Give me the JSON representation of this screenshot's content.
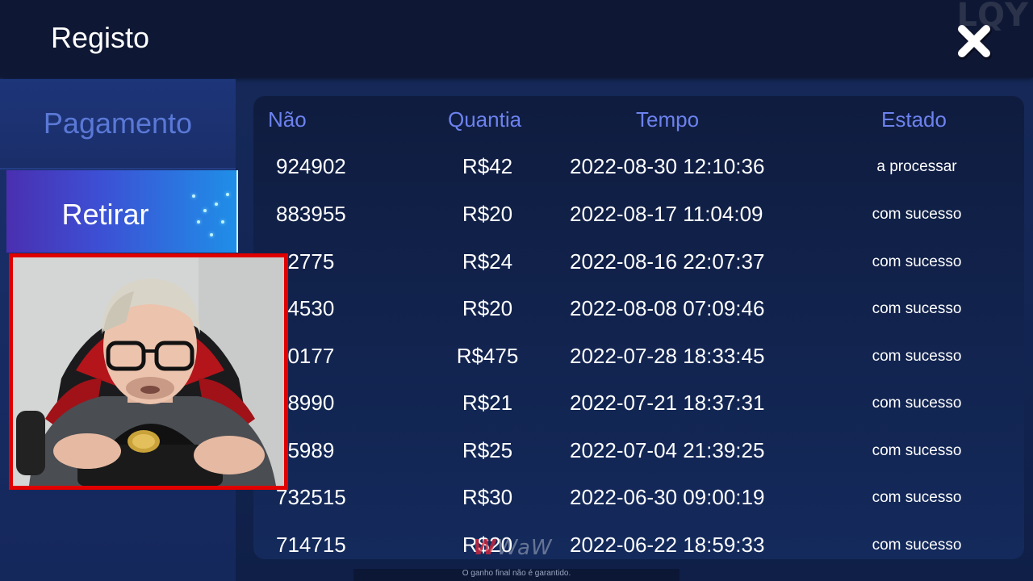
{
  "header": {
    "title": "Registo",
    "watermark": "LQY",
    "close_icon": "close-icon"
  },
  "sidebar": {
    "tabs": [
      {
        "label": "Pagamento",
        "active": false
      },
      {
        "label": "Retirar",
        "active": true
      }
    ]
  },
  "table": {
    "columns": [
      "Não",
      "Quantia",
      "Tempo",
      "Estado"
    ],
    "rows": [
      {
        "no": "924902",
        "amount": "R$42",
        "time": "2022-08-30 12:10:36",
        "status": "a processar"
      },
      {
        "no": "883955",
        "amount": "R$20",
        "time": "2022-08-17 11:04:09",
        "status": "com sucesso"
      },
      {
        "no": "82775",
        "amount": "R$24",
        "time": "2022-08-16 22:07:37",
        "status": "com sucesso"
      },
      {
        "no": "54530",
        "amount": "R$20",
        "time": "2022-08-08 07:09:46",
        "status": "com sucesso"
      },
      {
        "no": "20177",
        "amount": "R$475",
        "time": "2022-07-28 18:33:45",
        "status": "com sucesso"
      },
      {
        "no": "98990",
        "amount": "R$21",
        "time": "2022-07-21 18:37:31",
        "status": "com sucesso"
      },
      {
        "no": "45989",
        "amount": "R$25",
        "time": "2022-07-04 21:39:25",
        "status": "com sucesso"
      },
      {
        "no": "732515",
        "amount": "R$30",
        "time": "2022-06-30 09:00:19",
        "status": "com sucesso"
      },
      {
        "no": "714715",
        "amount": "R$20",
        "time": "2022-06-22 18:59:33",
        "status": "com sucesso"
      }
    ]
  },
  "footer": {
    "logo": "WaW",
    "disclaimer": "O ganho final não é garantido."
  },
  "colors": {
    "header_bg": "#0e1733",
    "accent": "#6d82ee",
    "webcam_border": "#e00000"
  }
}
